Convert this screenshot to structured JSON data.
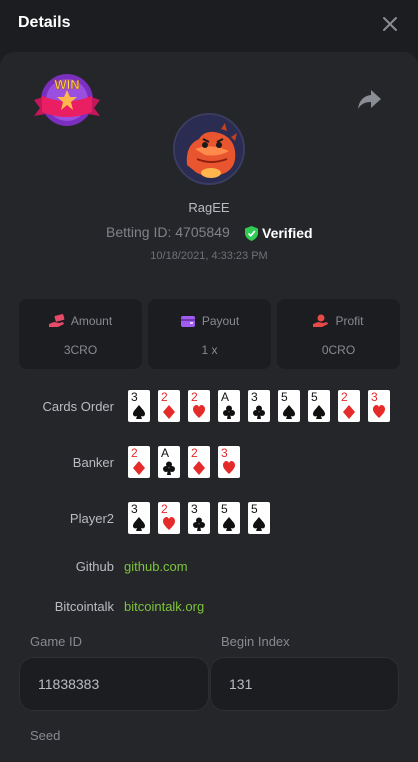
{
  "header": {
    "title": "Details"
  },
  "user": {
    "name": "RagEE",
    "betting_id_label": "Betting ID:",
    "betting_id": "4705849",
    "verified_label": "Verified",
    "datetime": "10/18/2021, 4:33:23 PM"
  },
  "badge": {
    "text": "WIN"
  },
  "stats": [
    {
      "label": "Amount",
      "value": "3CRO",
      "icon": "money-hand-icon",
      "color": "#e84a6a"
    },
    {
      "label": "Payout",
      "value": "1 x",
      "icon": "wallet-icon",
      "color": "#a05cf0"
    },
    {
      "label": "Profit",
      "value": "0CRO",
      "icon": "profit-hand-icon",
      "color": "#e84a4a"
    }
  ],
  "card_rows": [
    {
      "label": "Cards Order",
      "cards": [
        {
          "rank": "3",
          "suit": "spade"
        },
        {
          "rank": "2",
          "suit": "diamond"
        },
        {
          "rank": "2",
          "suit": "heart"
        },
        {
          "rank": "A",
          "suit": "club"
        },
        {
          "rank": "3",
          "suit": "club"
        },
        {
          "rank": "5",
          "suit": "spade"
        },
        {
          "rank": "5",
          "suit": "spade"
        },
        {
          "rank": "2",
          "suit": "diamond"
        },
        {
          "rank": "3",
          "suit": "heart"
        }
      ]
    },
    {
      "label": "Banker",
      "cards": [
        {
          "rank": "2",
          "suit": "diamond"
        },
        {
          "rank": "A",
          "suit": "club"
        },
        {
          "rank": "2",
          "suit": "diamond"
        },
        {
          "rank": "3",
          "suit": "heart"
        }
      ]
    },
    {
      "label": "Player2",
      "cards": [
        {
          "rank": "3",
          "suit": "spade"
        },
        {
          "rank": "2",
          "suit": "heart"
        },
        {
          "rank": "3",
          "suit": "club"
        },
        {
          "rank": "5",
          "suit": "spade"
        },
        {
          "rank": "5",
          "suit": "spade"
        }
      ]
    }
  ],
  "links": [
    {
      "label": "Github",
      "text": "github.com"
    },
    {
      "label": "Bitcointalk",
      "text": "bitcointalk.org"
    }
  ],
  "fields": {
    "game_id_label": "Game ID",
    "game_id": "11838383",
    "begin_index_label": "Begin Index",
    "begin_index": "131",
    "seed_label": "Seed"
  },
  "colors": {
    "accent_green": "#7dc43c",
    "verified_green": "#2ecc55",
    "background": "#1c1d20",
    "panel": "#252629"
  }
}
